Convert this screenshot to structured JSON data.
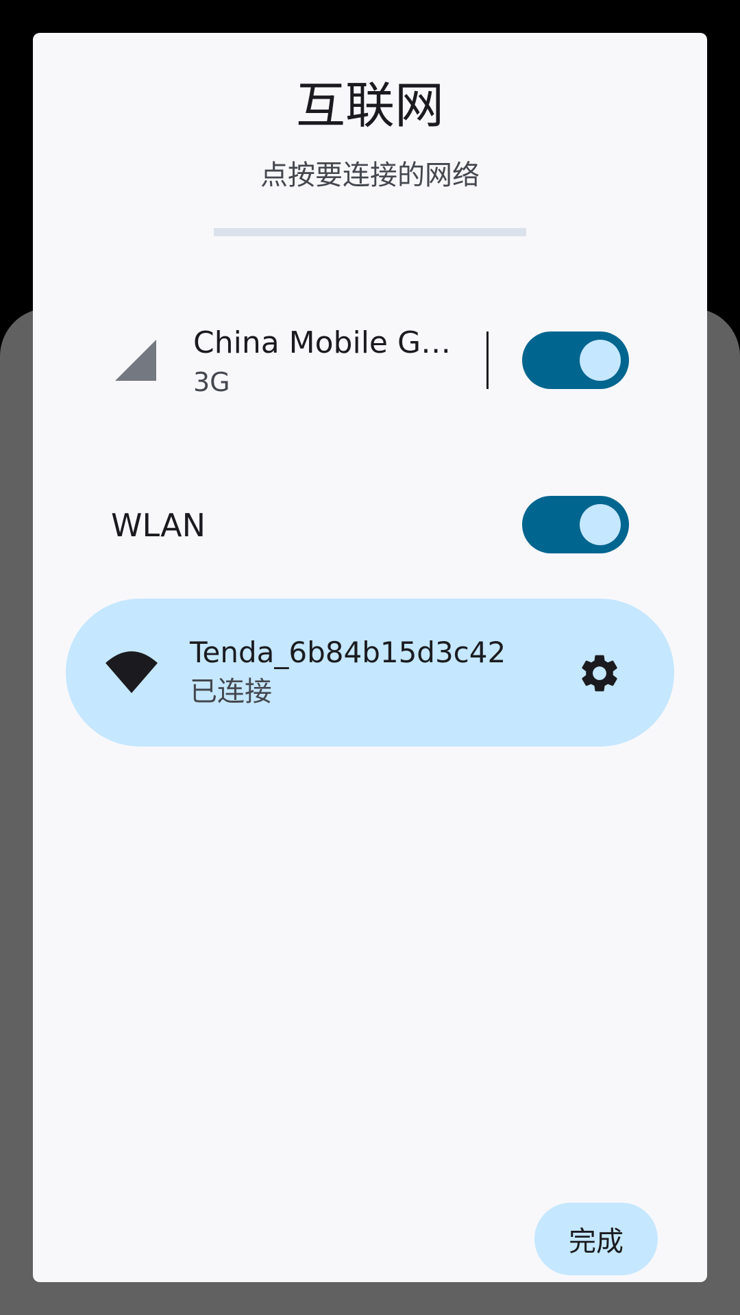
{
  "dialog": {
    "title": "互联网",
    "subtitle": "点按要连接的网络",
    "done_label": "完成"
  },
  "mobile": {
    "name": "China Mobile GS…",
    "type": "3G",
    "enabled": true,
    "icon": "cell-signal-icon"
  },
  "wlan": {
    "label": "WLAN",
    "enabled": true
  },
  "networks": [
    {
      "ssid": "Tenda_6b84b15d3c42",
      "status": "已连接",
      "icon": "wifi-icon",
      "settings_icon": "gear-icon"
    }
  ],
  "colors": {
    "accent": "#00658f",
    "accent_container": "#c5e7ff",
    "surface": "#f8f8fb",
    "scrim": "#616161"
  }
}
